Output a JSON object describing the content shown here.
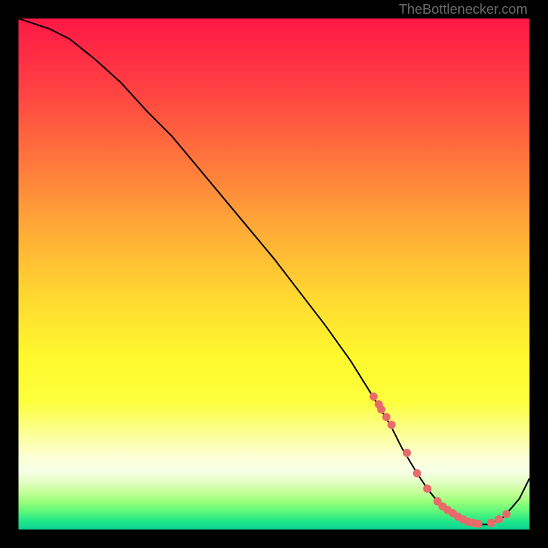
{
  "attribution": "TheBottlenecker.com",
  "chart_data": {
    "type": "line",
    "title": "",
    "xlabel": "",
    "ylabel": "",
    "xlim": [
      0,
      100
    ],
    "ylim": [
      0,
      100
    ],
    "x": [
      0,
      3,
      6,
      10,
      15,
      20,
      25,
      30,
      35,
      40,
      45,
      50,
      55,
      60,
      65,
      70,
      73,
      75,
      78,
      80,
      82,
      85,
      88,
      90,
      92,
      95,
      98,
      100
    ],
    "values": [
      100,
      99,
      98,
      96,
      92,
      87.5,
      82,
      77,
      71,
      65,
      59,
      53,
      46.5,
      40,
      33,
      25,
      20,
      16,
      11,
      8,
      5.5,
      3,
      1.5,
      1,
      1,
      2.5,
      6,
      10
    ],
    "markers": {
      "x": [
        69.5,
        70.5,
        71,
        72,
        73,
        76,
        78,
        80,
        82,
        83,
        84,
        85,
        86,
        87,
        88,
        89,
        90,
        92.5,
        94,
        95.5
      ],
      "values": [
        26,
        24.5,
        23.5,
        22,
        20.5,
        15,
        11,
        8,
        5.5,
        4.5,
        3.8,
        3.2,
        2.5,
        2.0,
        1.5,
        1.3,
        1.1,
        1.3,
        2.0,
        3.0
      ],
      "color": "#e96a6a"
    },
    "gradient_stops": [
      {
        "offset": 0.0,
        "color": "#ff1846"
      },
      {
        "offset": 0.12,
        "color": "#ff3b43"
      },
      {
        "offset": 0.25,
        "color": "#ff6b3e"
      },
      {
        "offset": 0.4,
        "color": "#ffa637"
      },
      {
        "offset": 0.55,
        "color": "#ffda30"
      },
      {
        "offset": 0.66,
        "color": "#fff82c"
      },
      {
        "offset": 0.75,
        "color": "#fdff3d"
      },
      {
        "offset": 0.82,
        "color": "#fcffa0"
      },
      {
        "offset": 0.86,
        "color": "#fbffd8"
      },
      {
        "offset": 0.885,
        "color": "#f8ffe6"
      },
      {
        "offset": 0.905,
        "color": "#e6ffc8"
      },
      {
        "offset": 0.925,
        "color": "#c8ff9d"
      },
      {
        "offset": 0.945,
        "color": "#9cff7c"
      },
      {
        "offset": 0.965,
        "color": "#5cf77a"
      },
      {
        "offset": 0.985,
        "color": "#1de58a"
      },
      {
        "offset": 1.0,
        "color": "#0cd492"
      }
    ]
  }
}
